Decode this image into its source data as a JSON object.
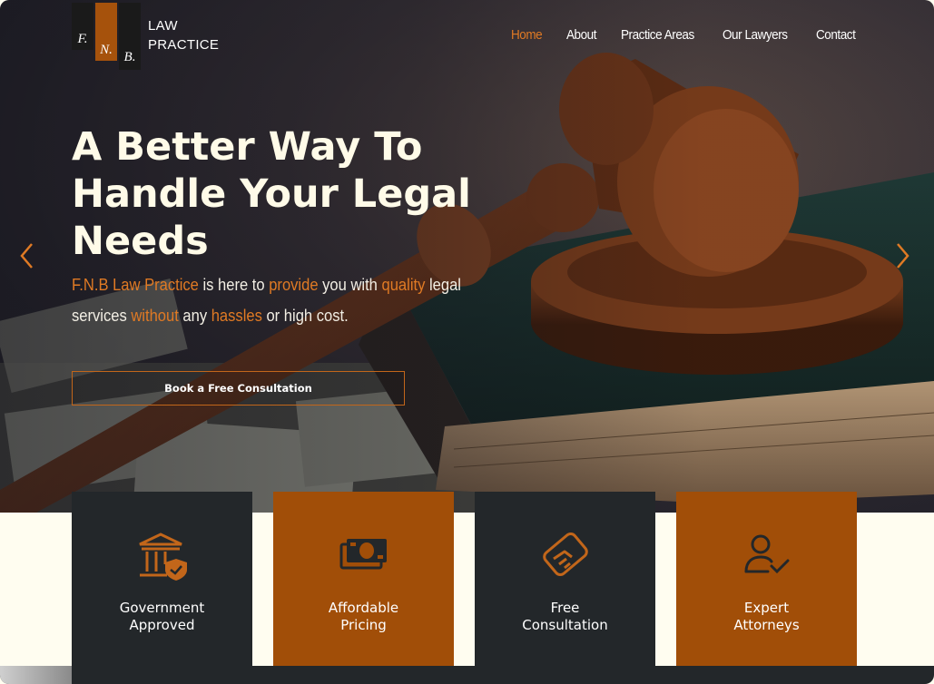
{
  "brand": {
    "logo_letters": [
      "F.",
      "N.",
      "B."
    ],
    "name_line1": "LAW",
    "name_line2": "PRACTICE",
    "accent_color": "#e07a24",
    "dark_color": "#23272a",
    "orange_color": "#a14e08"
  },
  "nav": {
    "items": [
      {
        "label": "Home",
        "active": true
      },
      {
        "label": "About",
        "active": false
      },
      {
        "label": "Practice Areas",
        "active": false
      },
      {
        "label": "Our Lawyers",
        "active": false
      },
      {
        "label": "Contact",
        "active": false
      }
    ]
  },
  "hero": {
    "title_line1": "A Better Way To",
    "title_line2": "Handle Your Legal",
    "title_line3": "Needs",
    "sub": {
      "p1": "F.N.B Law Practice",
      "p2": " is here to ",
      "p3": "provide",
      "p4": " you with ",
      "p5": "quality",
      "p6": " legal services ",
      "p7": "without",
      "p8": " any ",
      "p9": "hassles",
      "p10": " or high cost."
    },
    "cta_label": "Book a Free Consultation",
    "prev_icon": "chevron-left-icon",
    "next_icon": "chevron-right-icon"
  },
  "features": [
    {
      "line1": "Government",
      "line2": "Approved",
      "icon": "courthouse-shield-icon",
      "style": "dark"
    },
    {
      "line1": "Affordable",
      "line2": "Pricing",
      "icon": "money-icon",
      "style": "orange"
    },
    {
      "line1": "Free",
      "line2": "Consultation",
      "icon": "handshake-icon",
      "style": "dark"
    },
    {
      "line1": "Expert",
      "line2": "Attorneys",
      "icon": "user-check-icon",
      "style": "orange"
    }
  ]
}
